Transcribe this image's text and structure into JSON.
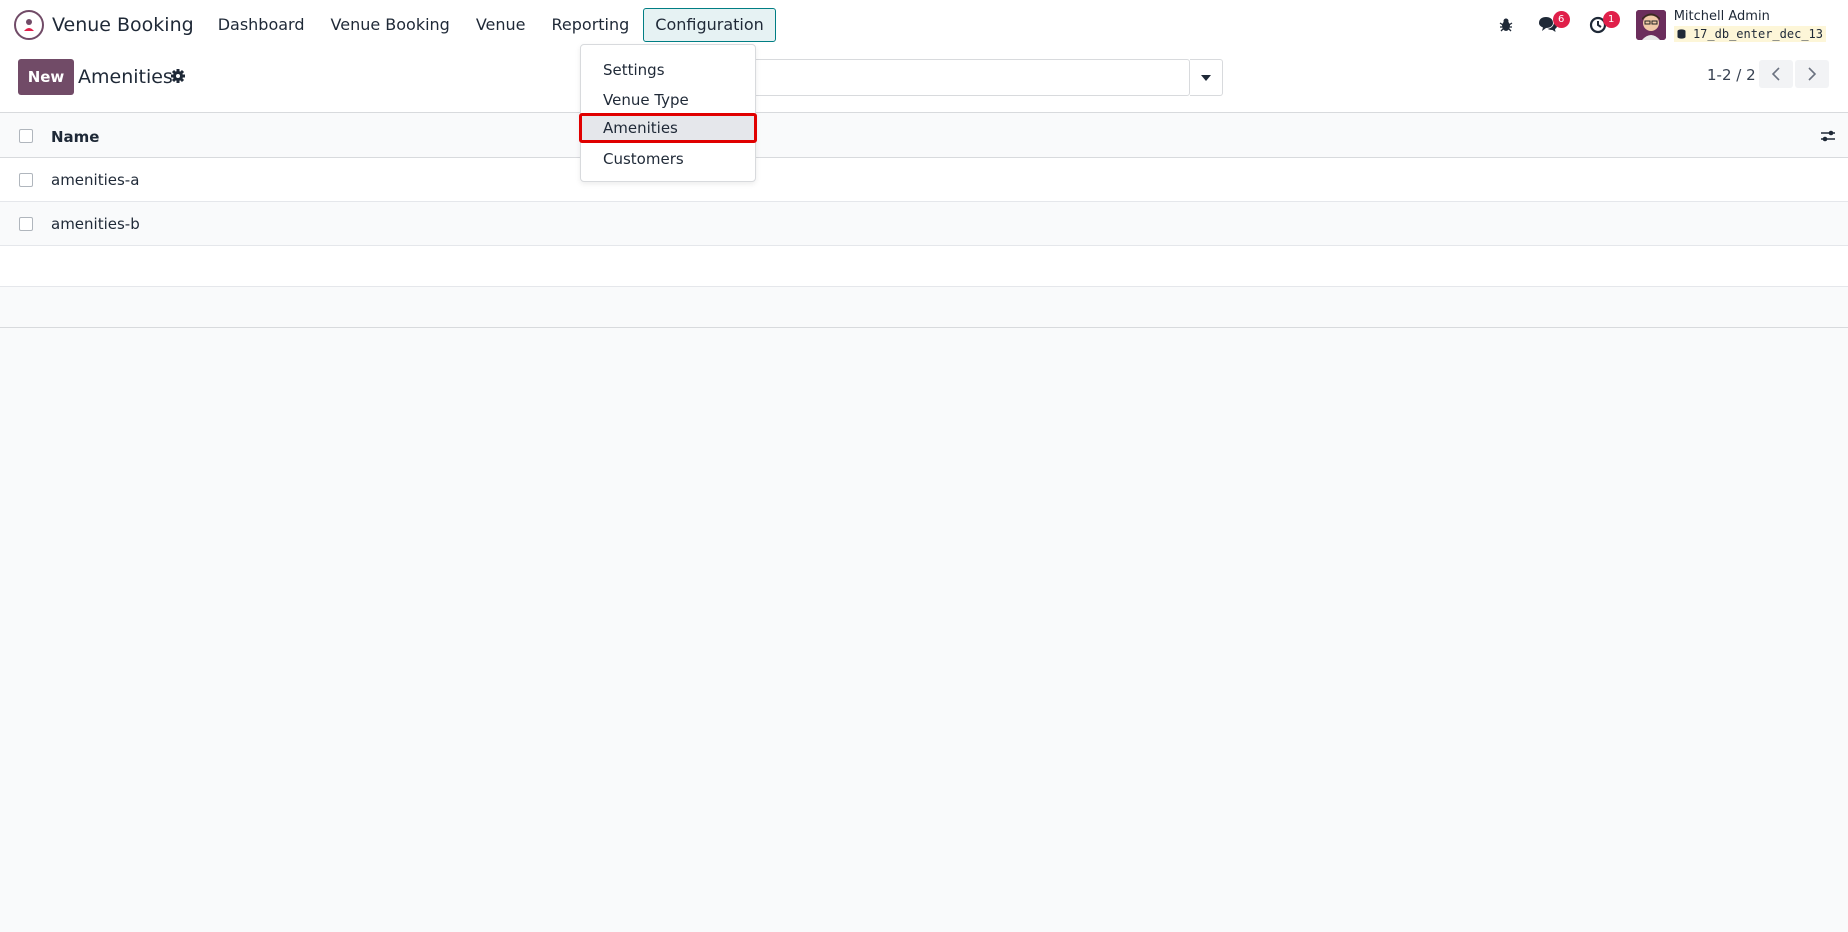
{
  "navbar": {
    "app_name": "Venue Booking",
    "menu": [
      "Dashboard",
      "Venue Booking",
      "Venue",
      "Reporting",
      "Configuration"
    ],
    "active_menu": "Configuration",
    "messages_count": "6",
    "activities_count": "1",
    "user_name": "Mitchell Admin",
    "db_name": "17_db_enter_dec_13"
  },
  "control_panel": {
    "new_label": "New",
    "title": "Amenities",
    "pager": "1-2 / 2"
  },
  "configuration_menu": {
    "items": [
      "Settings",
      "Venue Type",
      "Amenities",
      "Customers"
    ],
    "highlighted": "Amenities"
  },
  "list": {
    "column_name": "Name",
    "rows": [
      "amenities-a",
      "amenities-b"
    ]
  },
  "colors": {
    "brand": "#714B67",
    "active_menu_border": "#017e84",
    "highlight_border": "#e00000",
    "badge": "#e0204a"
  }
}
